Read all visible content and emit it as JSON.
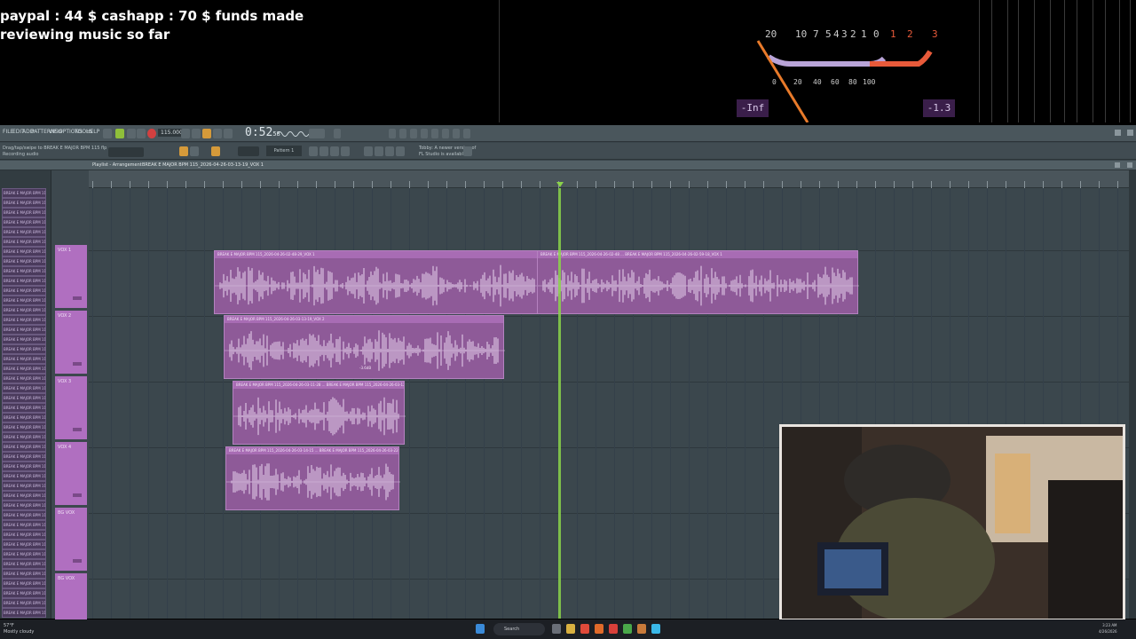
{
  "overlay": {
    "line1": "paypal : 44 $  cashapp : 70 $ funds made",
    "line2": "reviewing music so far"
  },
  "vu_meter": {
    "scale_top": [
      "20",
      "10",
      "7",
      "5",
      "4",
      "3",
      "2",
      "1",
      "0",
      "1",
      "2",
      "3"
    ],
    "scale_bottom": [
      "0",
      "20",
      "40",
      "60",
      "80",
      "100"
    ],
    "left_readout": "-Inf",
    "right_readout": "-1.3",
    "accent": "#e85a3a"
  },
  "daw": {
    "menu": [
      "FILE",
      "EDIT",
      "ADD",
      "PATTERNS",
      "VIEW",
      "OPTIONS",
      "TOOLS",
      "HELP"
    ],
    "tempo": "115.000",
    "time": "0:52",
    "time_sub": "58",
    "hint_line1": "Drag/tap/swipe to BREAK E MAJOR BPM 115 flp",
    "hint_line2": "Recording audio",
    "hint_right1": "Tobby: A newer version of",
    "hint_right2": "FL Studio is available",
    "pattern": "Pattern 1",
    "playlist_title": "Playlist - Arrangement",
    "playlist_clip": "BREAK E MAJOR BPM 115_2026-04-26-03-13-19_VOX 1",
    "tracks": [
      "VOX 1",
      "VOX 2",
      "VOX 3",
      "VOX 4",
      "BG VOX",
      "BG VOX"
    ],
    "browser_item": "BREAK E MAJOR BPM 115",
    "clips": [
      {
        "label": "BREAK E MAJOR BPM 115_2026-04-26-02-48-29_VOX 1"
      },
      {
        "label": "BREAK E MAJOR BPM 115_2026-04-26-02-48 ... BREAK E MAJOR BPM 115_2026-04-26-02-59-18_VOX 1"
      },
      {
        "label": "BREAK E MAJOR BPM 115_2026-04-26-03-13-19_VOX 2"
      },
      {
        "label": "BREAK E MAJOR BPM 115_2026-04-26-03-11-28 ... BREAK E MAJOR BPM 115_2026-04-26-03-12-41_VOX 3"
      },
      {
        "label": "BREAK E MAJOR BPM 115_2026-04-26-03-14-15 ... BREAK E MAJOR BPM 115_2026-04-26-03-22-48_VOX 4"
      }
    ],
    "db_label": "-3.6dB",
    "clip_color": "#8e5a98",
    "playhead_color": "#8bd34a"
  },
  "taskbar": {
    "weather_temp": "57°F",
    "weather_desc": "Mostly cloudy",
    "search_placeholder": "Search",
    "time": "3:23 AM",
    "date": "4/26/2026"
  }
}
